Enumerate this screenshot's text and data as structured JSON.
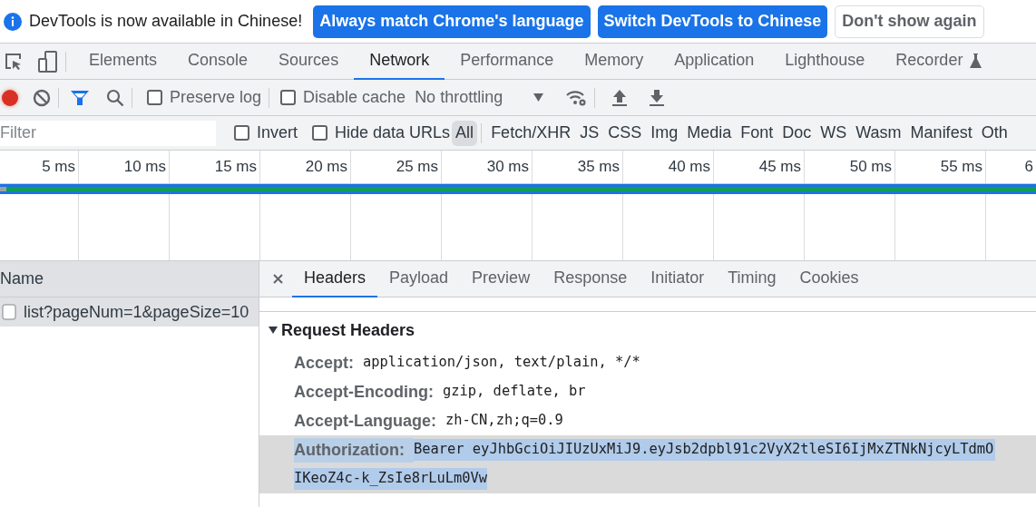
{
  "banner": {
    "message": "DevTools is now available in Chinese!",
    "buttons": [
      {
        "label": "Always match Chrome's language",
        "kind": "primary"
      },
      {
        "label": "Switch DevTools to Chinese",
        "kind": "primary"
      },
      {
        "label": "Don't show again",
        "kind": "secondary"
      }
    ]
  },
  "tabs": [
    {
      "label": "Elements",
      "selected": false,
      "experimental": false
    },
    {
      "label": "Console",
      "selected": false,
      "experimental": false
    },
    {
      "label": "Sources",
      "selected": false,
      "experimental": false
    },
    {
      "label": "Network",
      "selected": true,
      "experimental": false
    },
    {
      "label": "Performance",
      "selected": false,
      "experimental": false
    },
    {
      "label": "Memory",
      "selected": false,
      "experimental": false
    },
    {
      "label": "Application",
      "selected": false,
      "experimental": false
    },
    {
      "label": "Lighthouse",
      "selected": false,
      "experimental": false
    },
    {
      "label": "Recorder",
      "selected": false,
      "experimental": true
    }
  ],
  "toolbar": {
    "recording": true,
    "preserve_log": {
      "label": "Preserve log",
      "checked": false
    },
    "disable_cache": {
      "label": "Disable cache",
      "checked": false
    },
    "throttling": "No throttling"
  },
  "filter": {
    "placeholder": "Filter",
    "invert": {
      "label": "Invert",
      "checked": false
    },
    "hide_data_urls": {
      "label": "Hide data URLs",
      "checked": false
    },
    "types": [
      {
        "label": "All",
        "selected": true
      },
      {
        "label": "Fetch/XHR",
        "selected": false
      },
      {
        "label": "JS",
        "selected": false
      },
      {
        "label": "CSS",
        "selected": false
      },
      {
        "label": "Img",
        "selected": false
      },
      {
        "label": "Media",
        "selected": false
      },
      {
        "label": "Font",
        "selected": false
      },
      {
        "label": "Doc",
        "selected": false
      },
      {
        "label": "WS",
        "selected": false
      },
      {
        "label": "Wasm",
        "selected": false
      },
      {
        "label": "Manifest",
        "selected": false
      },
      {
        "label": "Oth",
        "selected": false
      }
    ]
  },
  "timeline": {
    "ticks": [
      "5 ms",
      "10 ms",
      "15 ms",
      "20 ms",
      "25 ms",
      "30 ms",
      "35 ms",
      "40 ms",
      "45 ms",
      "50 ms",
      "55 ms",
      "6"
    ]
  },
  "requests": {
    "column": "Name",
    "rows": [
      {
        "name": "list?pageNum=1&pageSize=10",
        "selected": true
      }
    ]
  },
  "details": {
    "tabs": [
      {
        "label": "Headers",
        "selected": true
      },
      {
        "label": "Payload",
        "selected": false
      },
      {
        "label": "Preview",
        "selected": false
      },
      {
        "label": "Response",
        "selected": false
      },
      {
        "label": "Initiator",
        "selected": false
      },
      {
        "label": "Timing",
        "selected": false
      },
      {
        "label": "Cookies",
        "selected": false
      }
    ],
    "section": {
      "title": "Request Headers",
      "expanded": true,
      "headers": [
        {
          "name": "Accept:",
          "value": "application/json, text/plain, */*",
          "selected": false
        },
        {
          "name": "Accept-Encoding:",
          "value": "gzip, deflate, br",
          "selected": false
        },
        {
          "name": "Accept-Language:",
          "value": "zh-CN,zh;q=0.9",
          "selected": false
        },
        {
          "name": "Authorization:",
          "value": "Bearer eyJhbGciOiJIUzUxMiJ9.eyJsb2dpbl91c2VyX2tleSI6IjMxZTNkNjcyLTdmO",
          "value_2": "IKeoZ4c-k_ZsIe8rLuLm0Vw",
          "selected": true
        }
      ]
    }
  }
}
